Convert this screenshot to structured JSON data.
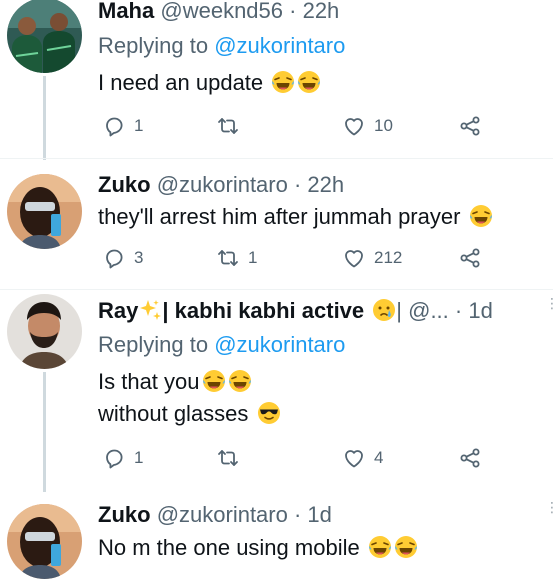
{
  "tweets": [
    {
      "name": "Maha",
      "handle": "@weeknd56",
      "time": "· 22h",
      "replying_prefix": "Replying to ",
      "replying_to": "@zukorintaro",
      "lines": [
        "I need an update"
      ],
      "replies": "1",
      "retweets": "",
      "likes": "10"
    },
    {
      "name": "Zuko",
      "handle": "@zukorintaro",
      "time": "· 22h",
      "lines": [
        "they'll arrest him after jummah prayer"
      ],
      "replies": "3",
      "retweets": "1",
      "likes": "212"
    },
    {
      "name": "Ray",
      "name_suffix": "| kabhi kabhi active",
      "handle": "| @...",
      "time": "· 1d",
      "replying_prefix": "Replying to ",
      "replying_to": "@zukorintaro",
      "lines": [
        "Is that you",
        "without glasses"
      ],
      "replies": "1",
      "retweets": "",
      "likes": "4"
    },
    {
      "name": "Zuko",
      "handle": "@zukorintaro",
      "time": "· 1d",
      "lines": [
        "No m the one using mobile"
      ]
    }
  ],
  "icons": {
    "reply": "reply-icon",
    "retweet": "retweet-icon",
    "like": "heart-icon",
    "share": "share-icon",
    "laughing": "laughing-crying-emoji",
    "crying": "crying-emoji",
    "cool": "sunglasses-emoji",
    "sparkles": "sparkles-emoji"
  },
  "colors": {
    "link": "#1d9bf0",
    "muted": "#536471",
    "text": "#0f1419",
    "thread_line": "#cfd9de"
  }
}
